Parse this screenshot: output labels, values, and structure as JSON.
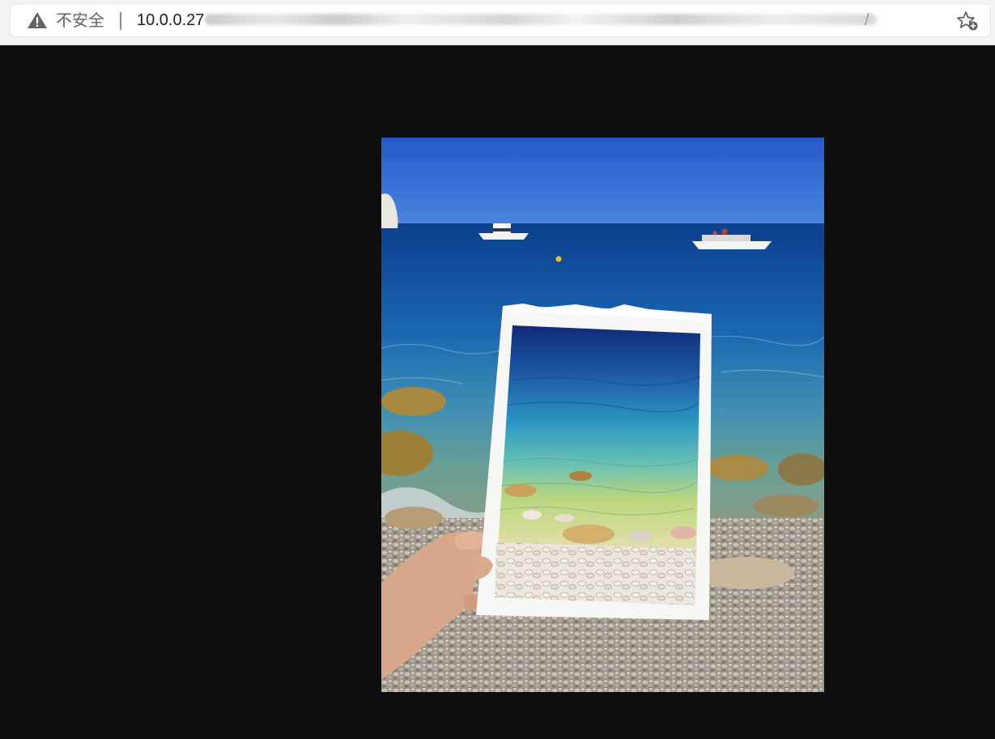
{
  "addressbar": {
    "security_label": "不安全",
    "url_host": "10.0.0.27",
    "url_tail": "/",
    "icons": {
      "security": "warning-triangle-icon",
      "bookmark": "add-bookmark-star-icon"
    }
  },
  "colors": {
    "viewer_background": "#0e0e0e",
    "toolbar_background": "#f1f3f4",
    "sky": "#2a5fd0",
    "sea": "#0f4a9a"
  }
}
